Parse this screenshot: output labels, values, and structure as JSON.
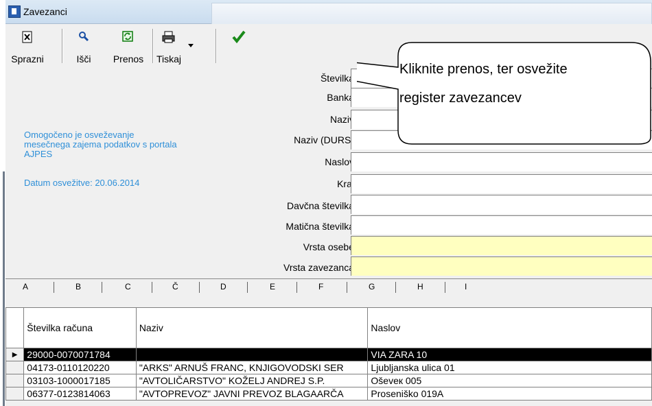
{
  "window": {
    "title": "Zavezanci"
  },
  "toolbar": {
    "buttons": [
      {
        "label": "Sprazni",
        "icon": "clear-document-icon"
      },
      {
        "label": "Išči",
        "icon": "search-icon"
      },
      {
        "label": "Prenos",
        "icon": "transfer-refresh-icon"
      },
      {
        "label": "Tiskaj",
        "icon": "printer-icon"
      },
      {
        "label": "",
        "icon": "checkmark-icon"
      }
    ]
  },
  "info": {
    "line1": "Omogočeno je osveževanje",
    "line2": "mesečnega zajema podatkov s portala",
    "line3": "AJPES",
    "date": "Datum osvežitve: 20.06.2014"
  },
  "form": {
    "fields": [
      {
        "label": "Številka"
      },
      {
        "label": "Banka"
      },
      {
        "label": "Naziv"
      },
      {
        "label": "Naziv (DURS)"
      },
      {
        "label": "Naslov"
      },
      {
        "label": "Kraj"
      },
      {
        "label": "Davčna številka"
      },
      {
        "label": "Matična številka"
      },
      {
        "label": "Vrsta osebe"
      },
      {
        "label": "Vrsta zavezanca"
      }
    ]
  },
  "column_letters": [
    "A",
    "B",
    "C",
    "Č",
    "D",
    "E",
    "F",
    "G",
    "H",
    "I"
  ],
  "table": {
    "headers": [
      "Številka računa",
      "Naziv",
      "Naslov"
    ],
    "rows": [
      {
        "account": "29000-0070071784",
        "name": "",
        "address": "VIA ZARA 10"
      },
      {
        "account": "04173-0110120220",
        "name": "\"ARKS\" ARNUŠ FRANC, KNJIGOVODSKI SER",
        "address": "Ljubljanska ulica 01"
      },
      {
        "account": "03103-1000017185",
        "name": "\"AVTOLIČARSTVO\" KOŽELJ ANDREJ S.P.",
        "address": "Oševeк 005"
      },
      {
        "account": "06377-0123814063",
        "name": "\"AVTOPREVOZ\" JAVNI PREVOZ BLAGAARČA",
        "address": "Proseniško 019A"
      }
    ]
  },
  "callout": {
    "line1": "Kliknite prenos, ter osvežite",
    "line2": "register zavezancev"
  },
  "colors": {
    "info_text": "#2e8fd8",
    "required_field": "#ffffc0",
    "selected_row": "#000000"
  }
}
